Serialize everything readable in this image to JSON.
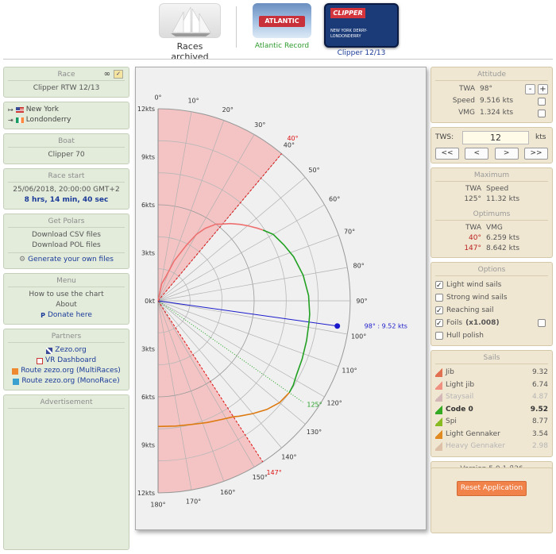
{
  "topbar": {
    "archived_label": "Races archived",
    "atlantic_logo": "ATLANTIC",
    "atlantic_label": "Atlantic Record",
    "clipper_logo": "CLIPPER",
    "clipper_thumb_text": "NEW YORK DERRY-LONDONDERRY",
    "clipper_label": "Clipper 12/13"
  },
  "left": {
    "race": {
      "title": "Race",
      "name": "Clipper RTW 12/13"
    },
    "route": {
      "from": "New York",
      "to": "Londonderry"
    },
    "boat": {
      "title": "Boat",
      "name": "Clipper 70"
    },
    "start": {
      "title": "Race start",
      "datetime": "25/06/2018, 20:00:00 GMT+2",
      "elapsed": "8 hrs, 14 min, 40 sec"
    },
    "polars": {
      "title": "Get Polars",
      "csv": "Download CSV files",
      "pol": "Download POL files",
      "generate": "Generate your own files"
    },
    "menu": {
      "title": "Menu",
      "howto": "How to use the chart",
      "about": "About",
      "donate": "Donate here"
    },
    "partners": {
      "title": "Partners",
      "items": [
        "Zezo.org",
        "VR Dashboard",
        "Route zezo.org (MultiRaces)",
        "Route zezo.org (MonoRace)"
      ]
    },
    "ad": {
      "title": "Advertisement"
    }
  },
  "chart": {
    "speed_ticks": [
      "12kts",
      "9kts",
      "6kts",
      "3kts",
      "0kt",
      "3kts",
      "6kts",
      "9kts",
      "12kts"
    ],
    "angle_labels": [
      "0°",
      "10°",
      "20°",
      "30°",
      "40°",
      "50°",
      "60°",
      "70°",
      "80°",
      "90°",
      "100°",
      "110°",
      "120°",
      "130°",
      "140°",
      "150°",
      "160°",
      "170°",
      "180°"
    ],
    "upwind_vmg_label": "40°",
    "downwind_vmg_label": "147°",
    "best_reach_label": "125°",
    "current_point_label": "98° : 9.52 kts",
    "colors": {
      "green": "#22a022",
      "orange": "#dd7a10",
      "pink": "#ee7070",
      "blue": "#1a1acc",
      "red": "#dd1111",
      "shade": "#f4c4c4"
    }
  },
  "chart_data": {
    "type": "line",
    "title": "",
    "r_max": 12,
    "current_twa": 98,
    "current_speed": 9.52,
    "series": [
      {
        "name": "Light jib",
        "points": [
          [
            3.5,
            0
          ],
          [
            12,
            1.1
          ],
          [
            18,
            1.6
          ],
          [
            22,
            2.7
          ],
          [
            27,
            3.9
          ],
          [
            30,
            4.8
          ],
          [
            33,
            5.4
          ],
          [
            37,
            6.0
          ],
          [
            40,
            6.26
          ],
          [
            43,
            6.6
          ],
          [
            47,
            7.0
          ],
          [
            50,
            7.3
          ],
          [
            54,
            7.7
          ],
          [
            56,
            7.9
          ]
        ]
      },
      {
        "name": "Code 0",
        "points": [
          [
            56,
            7.9
          ],
          [
            60,
            8.3
          ],
          [
            66,
            8.6
          ],
          [
            72,
            8.9
          ],
          [
            80,
            9.2
          ],
          [
            88,
            9.4
          ],
          [
            95,
            9.5
          ],
          [
            98,
            9.52
          ],
          [
            105,
            9.6
          ],
          [
            112,
            9.7
          ],
          [
            118,
            9.8
          ],
          [
            122,
            9.95
          ],
          [
            125,
            10.0
          ]
        ]
      },
      {
        "name": "Light Gennaker",
        "points": [
          [
            125,
            10.0
          ],
          [
            130,
            9.9
          ],
          [
            135,
            9.6
          ],
          [
            140,
            9.2
          ],
          [
            145,
            8.8
          ],
          [
            147,
            8.64
          ],
          [
            152,
            8.4
          ],
          [
            158,
            8.2
          ],
          [
            165,
            8.0
          ],
          [
            172,
            7.9
          ],
          [
            180,
            7.85
          ]
        ]
      }
    ]
  },
  "right": {
    "attitude": {
      "title": "Attitude",
      "twa_label": "TWA",
      "twa_value": "98°",
      "speed_label": "Speed",
      "speed_value": "9.516 kts",
      "vmg_label": "VMG",
      "vmg_value": "1.324 kts",
      "minus": "-",
      "plus": "+"
    },
    "tws": {
      "label": "TWS:",
      "value": "12",
      "unit": "kts",
      "btn_first": "<<",
      "btn_prev": "<",
      "btn_next": ">",
      "btn_last": ">>"
    },
    "maximum": {
      "title": "Maximum",
      "h1": "TWA",
      "h2": "Speed",
      "twa": "125°",
      "speed": "11.32 kts"
    },
    "optimums": {
      "title": "Optimums",
      "h1": "TWA",
      "h2": "VMG",
      "up_twa": "40°",
      "up_vmg": "6.259 kts",
      "down_twa": "147°",
      "down_vmg": "8.642 kts"
    },
    "options": {
      "title": "Options",
      "items": [
        {
          "label": "Light wind sails",
          "checked": true
        },
        {
          "label": "Strong wind sails",
          "checked": false
        },
        {
          "label": "Reaching sail",
          "checked": true
        },
        {
          "label": "Foils",
          "extra": "(x1.008)",
          "checked": true
        },
        {
          "label": "Hull polish",
          "checked": false
        }
      ]
    },
    "sails": {
      "title": "Sails",
      "items": [
        {
          "name": "Jib",
          "value": "9.32",
          "color": "#e07050"
        },
        {
          "name": "Light jib",
          "value": "6.74",
          "color": "#f09080"
        },
        {
          "name": "Staysail",
          "value": "4.87",
          "color": "#d4b8b8"
        },
        {
          "name": "Code 0",
          "value": "9.52",
          "color": "#33aa22"
        },
        {
          "name": "Spi",
          "value": "8.77",
          "color": "#88bb22"
        },
        {
          "name": "Light Gennaker",
          "value": "3.54",
          "color": "#e08a20"
        },
        {
          "name": "Heavy Gennaker",
          "value": "2.98",
          "color": "#dcc0a8"
        }
      ]
    },
    "version": "Version 5.0.1-β26",
    "reset": "Reset Application"
  }
}
